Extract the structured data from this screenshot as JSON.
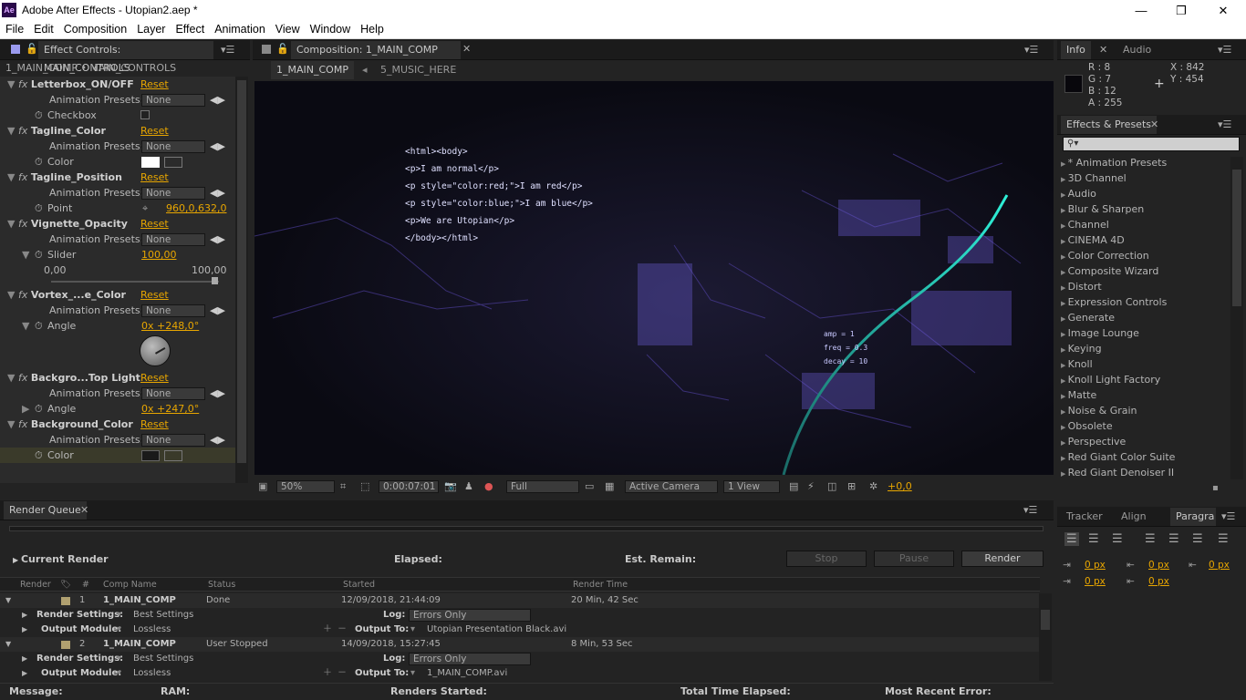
{
  "app": {
    "title": "Adobe After Effects - Utopian2.aep *",
    "logo": "Ae"
  },
  "window_controls": {
    "minimize": "—",
    "restore": "❐",
    "close": "✕"
  },
  "menu": [
    "File",
    "Edit",
    "Composition",
    "Layer",
    "Effect",
    "Animation",
    "View",
    "Window",
    "Help"
  ],
  "effect_controls": {
    "tab": "Effect Controls: MAIN_CONTROLS",
    "breadcrumb": "1_MAIN_COMP • MAIN_CONTROLS",
    "reset": "Reset",
    "presets_label": "Animation Presets:",
    "presets_value": "None",
    "effects": [
      {
        "name": "Letterbox_ON/OFF",
        "param": "Checkbox"
      },
      {
        "name": "Tagline_Color",
        "param": "Color"
      },
      {
        "name": "Tagline_Position",
        "param": "Point",
        "value": "960,0,632,0"
      },
      {
        "name": "Vignette_Opacity",
        "param": "Slider",
        "value": "100,00",
        "min": "0,00",
        "max": "100,00"
      },
      {
        "name": "Vortex_...e_Color",
        "param": "Angle",
        "value": "0x +248,0°"
      },
      {
        "name": "Backgro...Top Light",
        "param": "Angle",
        "value": "0x +247,0°"
      },
      {
        "name": "Background_Color",
        "param": "Color"
      }
    ],
    "colors": {
      "tagline": "#ffffff",
      "background": "#1a1a1a"
    }
  },
  "composition": {
    "tab": "Composition: 1_MAIN_COMP",
    "sub_tabs": [
      "1_MAIN_COMP",
      "5_MUSIC_HERE"
    ],
    "code_lines": [
      "<html><body>",
      "<p>I am normal</p>",
      "<p style=\"color:red;\">I am red</p>",
      "<p style=\"color:blue;\">I am blue</p>",
      "<p>We are Utopian</p>",
      "</body></html>"
    ],
    "code_small": [
      "amp = 1",
      "freq = 0.3",
      "decay = 10"
    ],
    "toolbar": {
      "zoom": "50%",
      "timecode": "0:00:07:01",
      "resolution": "Full",
      "camera": "Active Camera",
      "views": "1 View",
      "exposure": "+0,0"
    }
  },
  "info": {
    "tabs": [
      "Info",
      "Audio"
    ],
    "r": "R : 8",
    "g": "G : 7",
    "b": "B : 12",
    "a": "A : 255",
    "x": "X : 842",
    "y": "Y : 454"
  },
  "effects_presets": {
    "tab": "Effects & Presets",
    "search_placeholder": "",
    "items": [
      "* Animation Presets",
      "3D Channel",
      "Audio",
      "Blur & Sharpen",
      "Channel",
      "CINEMA 4D",
      "Color Correction",
      "Composite Wizard",
      "Distort",
      "Expression Controls",
      "Generate",
      "Image Lounge",
      "Keying",
      "Knoll",
      "Knoll Light Factory",
      "Matte",
      "Noise & Grain",
      "Obsolete",
      "Perspective",
      "Red Giant Color Suite",
      "Red Giant Denoiser II"
    ]
  },
  "paragraph": {
    "tabs": [
      "Tracker",
      "Align",
      "Paragra"
    ],
    "values": [
      "0 px",
      "0 px",
      "0 px",
      "0 px",
      "0 px"
    ]
  },
  "render_queue": {
    "tab": "Render Queue",
    "current_render": "Current Render",
    "elapsed": "Elapsed:",
    "est_remain": "Est. Remain:",
    "buttons": {
      "stop": "Stop",
      "pause": "Pause",
      "render": "Render"
    },
    "columns": [
      "Render",
      "#",
      "Comp Name",
      "Status",
      "Started",
      "Render Time"
    ],
    "labels": {
      "render_settings": "Render Settings:",
      "output_module": "Output Module:",
      "log": "Log:",
      "output_to": "Output To:"
    },
    "items": [
      {
        "num": "1",
        "comp": "1_MAIN_COMP",
        "status": "Done",
        "started": "12/09/2018, 21:44:09",
        "time": "20 Min, 42 Sec",
        "settings": "Best Settings",
        "module": "Lossless",
        "log": "Errors Only",
        "output": "Utopian Presentation Black.avi"
      },
      {
        "num": "2",
        "comp": "1_MAIN_COMP",
        "status": "User Stopped",
        "started": "14/09/2018, 15:27:45",
        "time": "8 Min, 53 Sec",
        "settings": "Best Settings",
        "module": "Lossless",
        "log": "Errors Only",
        "output": "1_MAIN_COMP.avi"
      }
    ],
    "footer": {
      "message": "Message:",
      "ram": "RAM:",
      "renders_started": "Renders Started:",
      "total_time": "Total Time Elapsed:",
      "recent_error": "Most Recent Error:"
    }
  }
}
